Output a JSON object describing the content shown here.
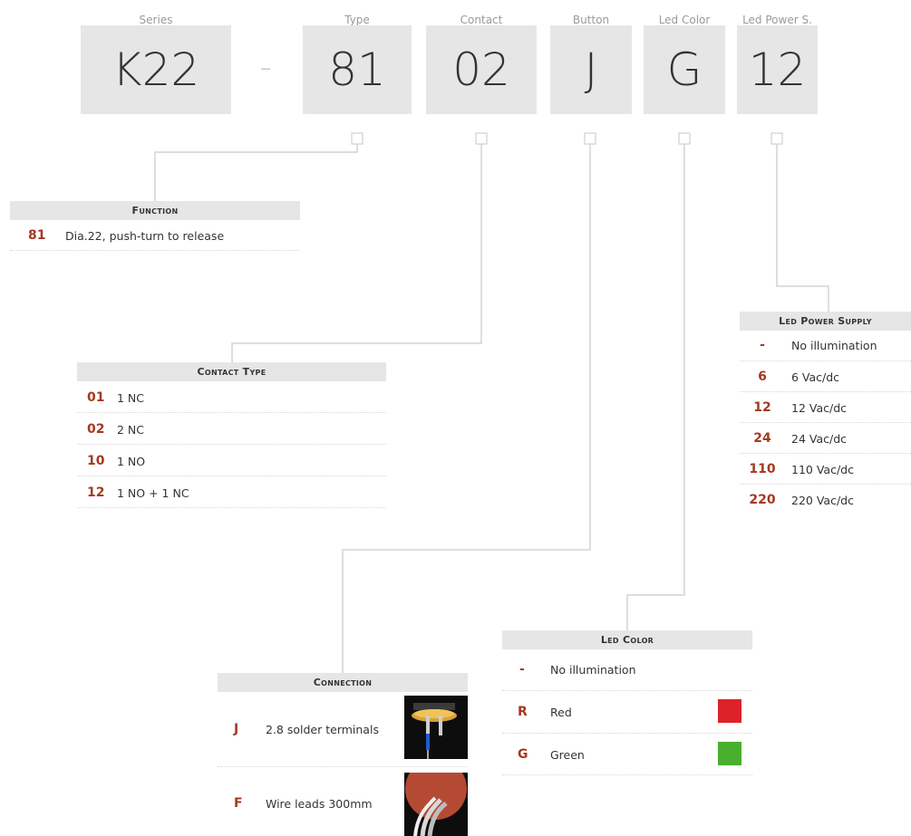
{
  "header": {
    "separator": "-",
    "segments": [
      {
        "label": "Series",
        "code": "K22"
      },
      {
        "label": "Type",
        "code": "81"
      },
      {
        "label": "Contact",
        "code": "02"
      },
      {
        "label": "Button",
        "code": "J"
      },
      {
        "label": "Led Color",
        "code": "G"
      },
      {
        "label": "Led Power S.",
        "code": "12"
      }
    ]
  },
  "function": {
    "title": "Function",
    "rows": [
      {
        "code": "81",
        "desc": "Dia.22, push-turn to release"
      }
    ]
  },
  "contact_type": {
    "title": "Contact Type",
    "rows": [
      {
        "code": "01",
        "desc": "1 NC"
      },
      {
        "code": "02",
        "desc": "2 NC"
      },
      {
        "code": "10",
        "desc": "1 NO"
      },
      {
        "code": "12",
        "desc": "1 NO + 1 NC"
      }
    ]
  },
  "led_power_supply": {
    "title": "Led Power Supply",
    "rows": [
      {
        "code": "-",
        "desc": "No illumination"
      },
      {
        "code": "6",
        "desc": "6 Vac/dc"
      },
      {
        "code": "12",
        "desc": "12 Vac/dc"
      },
      {
        "code": "24",
        "desc": "24 Vac/dc"
      },
      {
        "code": "110",
        "desc": "110 Vac/dc"
      },
      {
        "code": "220",
        "desc": "220 Vac/dc"
      }
    ]
  },
  "led_color": {
    "title": "Led Color",
    "rows": [
      {
        "code": "-",
        "desc": "No illumination",
        "swatch": ""
      },
      {
        "code": "R",
        "desc": "Red",
        "swatch": "#dd2229"
      },
      {
        "code": "G",
        "desc": "Green",
        "swatch": "#4aae2f"
      }
    ]
  },
  "connection": {
    "title": "Connection",
    "rows": [
      {
        "code": "J",
        "desc": "2.8  solder terminals",
        "image": "solder-terminals-photo"
      },
      {
        "code": "F",
        "desc": "Wire leads 300mm",
        "image": "wire-leads-photo"
      }
    ]
  },
  "colors": {
    "code_accent": "#a33a1f",
    "box_bg": "#e6e6e6",
    "connector_line": "#d4d4d4"
  }
}
